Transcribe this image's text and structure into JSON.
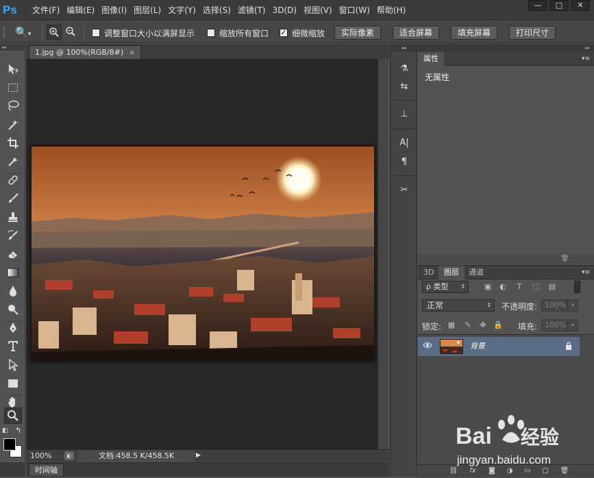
{
  "app": {
    "logo": "Ps"
  },
  "menu": [
    "文件(F)",
    "编辑(E)",
    "图像(I)",
    "图层(L)",
    "文字(Y)",
    "选择(S)",
    "滤镜(T)",
    "3D(D)",
    "视图(V)",
    "窗口(W)",
    "帮助(H)"
  ],
  "window_controls": {
    "minimize": "—",
    "maximize": "□",
    "close": "✕"
  },
  "options": {
    "tool_icon": "🔍",
    "tool_arrow": "▾",
    "zoom_in": "+",
    "zoom_out": "−",
    "resize_window": {
      "label": "调整窗口大小以满屏显示",
      "checked": false,
      "mark": ""
    },
    "zoom_all": {
      "label": "缩放所有窗口",
      "checked": false,
      "mark": ""
    },
    "scrubby": {
      "label": "细微缩放",
      "checked": true,
      "mark": "✓"
    },
    "actual_pixels": "实际像素",
    "fit_screen": "适合屏幕",
    "fill_screen": "填充屏幕",
    "print_size": "打印尺寸"
  },
  "document": {
    "tab_title": "1.jpg @ 100%(RGB/8#)",
    "tab_close": "×",
    "zoom": "100%",
    "info": "文档:458.5 K/458.5K",
    "status_arrow": "▶"
  },
  "timeline": {
    "label": "时间轴"
  },
  "properties": {
    "tab": "属性",
    "empty": "无属性"
  },
  "layers": {
    "tabs": [
      "3D",
      "图层",
      "通道"
    ],
    "active_tab": "图层",
    "filter_kind": "ρ 类型",
    "blend_mode": "正常",
    "opacity_label": "不透明度:",
    "opacity_value": "100%",
    "lock_label": "锁定:",
    "fill_label": "填充:",
    "fill_value": "100%",
    "items": [
      {
        "name": "背景",
        "visible": true,
        "locked": true
      }
    ]
  },
  "watermark": {
    "brand_text": "Bai",
    "brand_text2": "经验",
    "url": "jingyan.baidu.com"
  },
  "colors": {
    "menubar": "#3b3b3b",
    "panel": "#535353",
    "canvas": "#282828",
    "layer_selected": "#5b6d85",
    "ps_logo": "#31a8ff"
  }
}
